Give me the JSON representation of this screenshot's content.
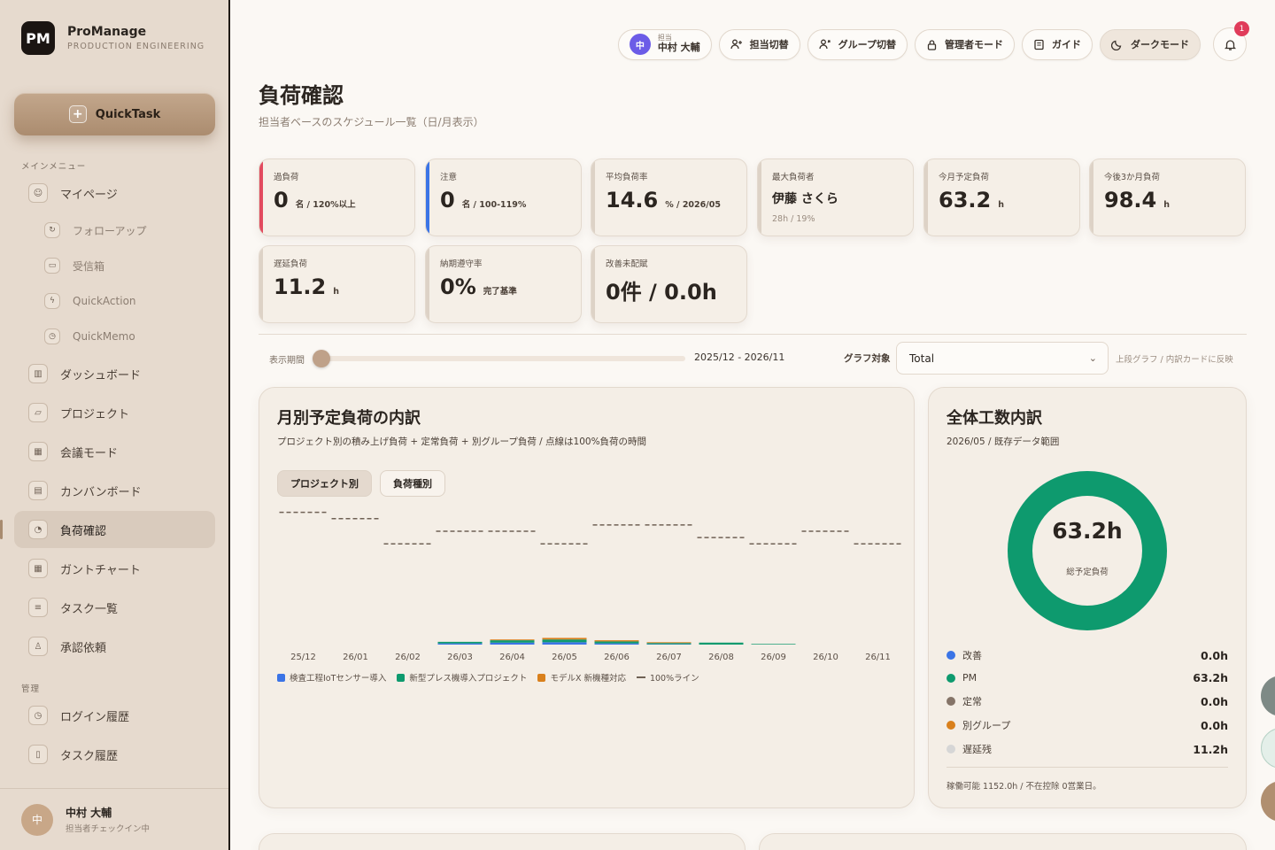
{
  "brand": {
    "logo": "PM",
    "name": "ProManage",
    "subtitle": "PRODUCTION ENGINEERING"
  },
  "quicktask": {
    "label": "QuickTask",
    "icon": "plus-icon"
  },
  "sidebar": {
    "main_label": "メインメニュー",
    "items": [
      {
        "label": "マイページ",
        "icon": "user-icon",
        "glyph": "☺"
      },
      {
        "label": "フォローアップ",
        "icon": "followup-icon",
        "glyph": "↻"
      },
      {
        "label": "受信箱",
        "icon": "inbox-icon",
        "glyph": "▭"
      },
      {
        "label": "QuickAction",
        "icon": "bolt-icon",
        "glyph": "ϟ"
      },
      {
        "label": "QuickMemo",
        "icon": "clock-icon",
        "glyph": "◷"
      },
      {
        "label": "ダッシュボード",
        "icon": "bar-chart-icon",
        "glyph": "▥"
      },
      {
        "label": "プロジェクト",
        "icon": "folder-icon",
        "glyph": "▱"
      },
      {
        "label": "会議モード",
        "icon": "presentation-icon",
        "glyph": "▦"
      },
      {
        "label": "カンバンボード",
        "icon": "kanban-icon",
        "glyph": "▤"
      },
      {
        "label": "負荷確認",
        "icon": "gauge-icon",
        "glyph": "◔"
      },
      {
        "label": "ガントチャート",
        "icon": "calendar-icon",
        "glyph": "▦"
      },
      {
        "label": "タスク一覧",
        "icon": "list-icon",
        "glyph": "≡"
      },
      {
        "label": "承認依頼",
        "icon": "approval-icon",
        "glyph": "♙"
      }
    ],
    "admin_label": "管理",
    "admin_items": [
      {
        "label": "ログイン履歴",
        "icon": "history-icon",
        "glyph": "◷"
      },
      {
        "label": "タスク履歴",
        "icon": "document-icon",
        "glyph": "▯"
      }
    ],
    "footer": {
      "avatar": "中",
      "name": "中村 大輔",
      "status": "担当者チェックイン中"
    }
  },
  "toolbar": {
    "user_avatar": "中",
    "user_caption": "担当",
    "user_name": "中村 大輔",
    "assignee_switch": "担当切替",
    "group_switch": "グループ切替",
    "admin_mode": "管理者モード",
    "guide": "ガイド",
    "dark_mode": "ダークモード",
    "notification_count": "1"
  },
  "page": {
    "title": "負荷確認",
    "subtitle": "担当者ベースのスケジュール一覧（日/月表示）"
  },
  "kpis": {
    "overload": {
      "label": "過負荷",
      "value": "0",
      "unit": "名 / 120%以上"
    },
    "caution": {
      "label": "注意",
      "value": "0",
      "unit": "名 / 100-119%"
    },
    "avg_rate": {
      "label": "平均負荷率",
      "value": "14.6",
      "unit": "% / 2026/05"
    },
    "max_person": {
      "label": "最大負荷者",
      "name": "伊藤 さくら",
      "sub": "28h / 19%"
    },
    "this_month": {
      "label": "今月予定負荷",
      "value": "63.2",
      "unit": "h"
    },
    "next3": {
      "label": "今後3か月負荷",
      "value": "98.4",
      "unit": "h"
    },
    "delayed": {
      "label": "遅延負荷",
      "value": "11.2",
      "unit": "h"
    },
    "deadline": {
      "label": "納期遵守率",
      "value": "0%",
      "unit": "完了基準"
    },
    "improve": {
      "label": "改善未配賦",
      "value": "0件 / 0.0h"
    }
  },
  "filters": {
    "range_label": "表示期間",
    "range_value": "2025/12 - 2026/11",
    "target_label": "グラフ対象",
    "target_value": "Total",
    "hint": "上段グラフ / 内訳カードに反映"
  },
  "monthly_panel": {
    "title": "月別予定負荷の内訳",
    "desc": "プロジェクト別の積み上げ負荷 + 定常負荷 + 別グループ負荷 / 点線は100%負荷の時間",
    "tab_project": "プロジェクト別",
    "tab_type": "負荷種別",
    "legend": [
      "検査工程IoTセンサー導入",
      "新型プレス機導入プロジェクト",
      "モデルX 新機種対応",
      "100%ライン"
    ]
  },
  "chart_data": {
    "type": "bar",
    "stacked": true,
    "categories": [
      "25/12",
      "26/01",
      "26/02",
      "26/03",
      "26/04",
      "26/05",
      "26/06",
      "26/07",
      "26/08",
      "26/09",
      "26/10",
      "26/11"
    ],
    "series": [
      {
        "name": "検査工程IoTセンサー導入",
        "color": "#3b74e6",
        "values": [
          0,
          0,
          0,
          1.5,
          2.5,
          3.0,
          1.5,
          0.5,
          0,
          0,
          0,
          0
        ]
      },
      {
        "name": "新型プレス機導入プロジェクト",
        "color": "#0e9a6e",
        "values": [
          0,
          0,
          0,
          2.0,
          3.0,
          3.5,
          2.5,
          1.5,
          2.5,
          0.8,
          0,
          0
        ]
      },
      {
        "name": "モデルX 新機種対応",
        "color": "#d9801c",
        "values": [
          0,
          0,
          0,
          0,
          1.0,
          2.0,
          1.5,
          1.0,
          0,
          0,
          0,
          0
        ]
      }
    ],
    "capacity_line": {
      "name": "100%ライン",
      "values": [
        168,
        160,
        128,
        144,
        144,
        128,
        152,
        152,
        136,
        128,
        144,
        128
      ]
    },
    "ylim": [
      0,
      180
    ],
    "grid": false,
    "legend": "bottom-left"
  },
  "breakdown_panel": {
    "title": "全体工数内訳",
    "subtitle": "2026/05 / 既存データ範囲",
    "total": "63.2h",
    "total_label": "総予定負荷",
    "items": [
      {
        "label": "改善",
        "value": "0.0h",
        "color": "#3b74e6",
        "hours": 0
      },
      {
        "label": "PM",
        "value": "63.2h",
        "color": "#0e9a6e",
        "hours": 63.2
      },
      {
        "label": "定常",
        "value": "0.0h",
        "color": "#857468",
        "hours": 0
      },
      {
        "label": "別グループ",
        "value": "0.0h",
        "color": "#d9801c",
        "hours": 0
      },
      {
        "label": "遅延残",
        "value": "11.2h",
        "color": "#d6d6d6",
        "hours": 11.2
      }
    ],
    "footnote": "稼働可能 1152.0h / 不在控除 0営業日。"
  },
  "colors": {
    "accent": "#b09275",
    "danger": "#e24a5e",
    "info": "#3b74e6",
    "success": "#0e9a6e"
  }
}
